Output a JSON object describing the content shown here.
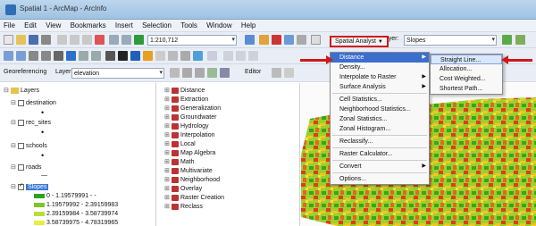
{
  "window": {
    "title": "Spatial 1 - ArcMap - ArcInfo"
  },
  "menubar": [
    "File",
    "Edit",
    "View",
    "Bookmarks",
    "Insert",
    "Selection",
    "Tools",
    "Window",
    "Help"
  ],
  "toolbar1": {
    "scale": "1:210,712",
    "spatial_analyst_label": "Spatial Analyst",
    "layer_label": "Layer:",
    "layer_value": "Slopes"
  },
  "toolbar3": {
    "georef_label": "Georeferencing",
    "layer_label": "Layer:",
    "layer_value": "elevation",
    "editor_label": "Editor"
  },
  "toc": {
    "title": "Layers",
    "layers": [
      "destination",
      "rec_sites",
      "schools",
      "roads",
      "Slopes"
    ],
    "legend": [
      "0 - 1.19579991 - -",
      "1.19579992 - 2.39159983",
      "2.39159984 - 3.58739974",
      "3.58739975 - 4.78319965"
    ]
  },
  "catalog": [
    "Distance",
    "Extraction",
    "Generalization",
    "Groundwater",
    "Hydrology",
    "Interpolation",
    "Local",
    "Map Algebra",
    "Math",
    "Multivariate",
    "Neighborhood",
    "Overlay",
    "Raster Creation",
    "Reclass"
  ],
  "menu": {
    "items": [
      "Distance",
      "Density...",
      "Interpolate to Raster",
      "Surface Analysis",
      "Cell Statistics...",
      "Neighborhood Statistics...",
      "Zonal Statistics...",
      "Zonal Histogram...",
      "Reclassify...",
      "Raster Calculator...",
      "Convert",
      "Options..."
    ]
  },
  "submenu": {
    "items": [
      "Straight Line...",
      "Allocation...",
      "Cost Weighted...",
      "Shortest Path..."
    ]
  },
  "colors": {
    "highlight": "#3c6ed0",
    "annotation_red": "#d01818"
  }
}
